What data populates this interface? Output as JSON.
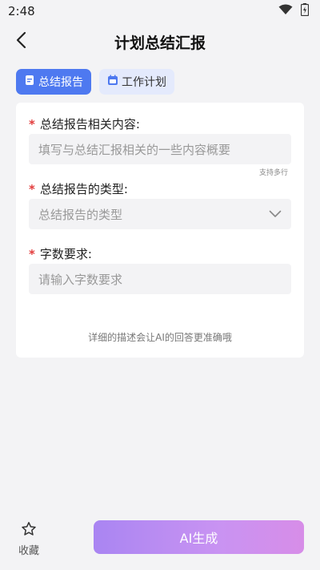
{
  "status_bar": {
    "time": "2:48"
  },
  "header": {
    "title": "计划总结汇报"
  },
  "tabs": [
    {
      "label": "总结报告",
      "active": true
    },
    {
      "label": "工作计划",
      "active": false
    }
  ],
  "form": {
    "fields": [
      {
        "label": "总结报告相关内容:",
        "placeholder": "填写与总结汇报相关的一些内容概要",
        "hint": "支持多行"
      },
      {
        "label": "总结报告的类型:",
        "placeholder": "总结报告的类型"
      },
      {
        "label": "字数要求:",
        "placeholder": "请输入字数要求"
      }
    ],
    "tip": "详细的描述会让AI的回答更准确哦"
  },
  "bottom": {
    "favorite_label": "收藏",
    "generate_label": "AI生成"
  },
  "colors": {
    "accent": "#4e79f0",
    "required": "#e23b3b",
    "button_gradient_start": "#a985f2",
    "button_gradient_end": "#d78de8"
  }
}
